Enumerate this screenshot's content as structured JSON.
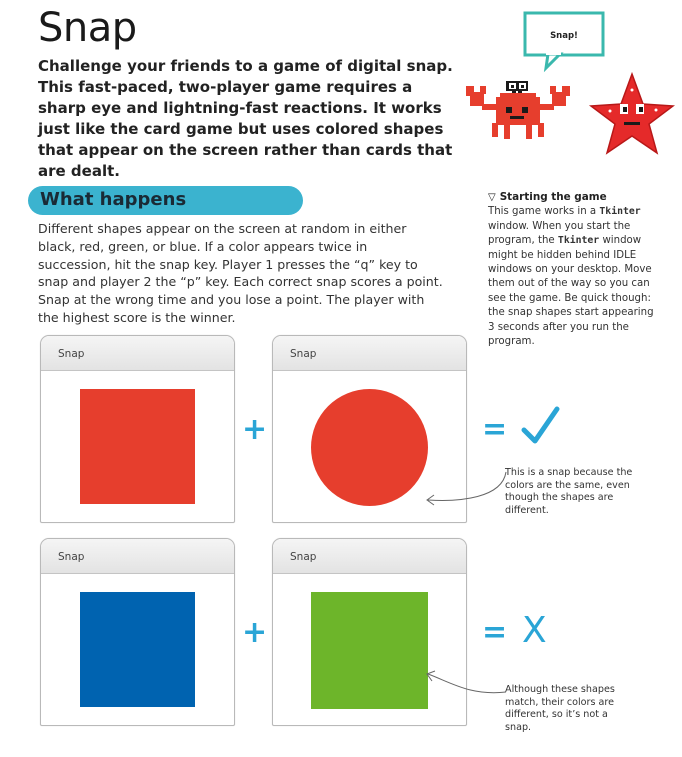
{
  "page": {
    "title": "Snap",
    "intro": "Challenge your friends to a game of digital snap. This fast-paced, two-player game requires a sharp eye and lightning-fast reactions. It works just like the card game but uses colored shapes that appear on the screen rather than cards that are dealt."
  },
  "speech_bubble": {
    "text": "Snap!"
  },
  "section": {
    "heading": "What happens",
    "body": "Different shapes appear on the screen at random in either black, red, green, or blue. If a color appears twice in succession, hit the snap key. Player 1 presses the “q” key to snap and player 2 the “p” key. Each correct snap scores a point. Snap at the wrong time and you lose a point. The player with the highest score is the winner."
  },
  "sidebar": {
    "marker": "▽",
    "heading": "Starting the game",
    "text_1": "This game works in a ",
    "code_1": "Tkinter",
    "text_2": " window. When you start the program, the ",
    "code_2": "Tkinter",
    "text_3": " window might be hidden behind IDLE windows on your desktop. Move them out of the way so you can see the game. Be quick though: the snap shapes start appearing 3 seconds after you run the program."
  },
  "examples": [
    {
      "left_window": {
        "title": "Snap",
        "shape": "square",
        "color": "#e63e2d"
      },
      "right_window": {
        "title": "Snap",
        "shape": "circle",
        "color": "#e63e2d"
      },
      "plus": "+",
      "equals": "=",
      "result": "✓",
      "annotation": "This is a snap because the colors are the same, even though the shapes are different."
    },
    {
      "left_window": {
        "title": "Snap",
        "shape": "square",
        "color": "#0063b0"
      },
      "right_window": {
        "title": "Snap",
        "shape": "square",
        "color": "#6db52a"
      },
      "plus": "+",
      "equals": "=",
      "result": "X",
      "annotation": "Although these shapes match, their colors are different, so it’s not a snap."
    }
  ],
  "colors": {
    "accent": "#2aa5d6",
    "section_band": "#3bb3cf",
    "bubble_border": "#3ab8ad",
    "crab_red": "#e63e2d",
    "star_red": "#e52a2a"
  }
}
